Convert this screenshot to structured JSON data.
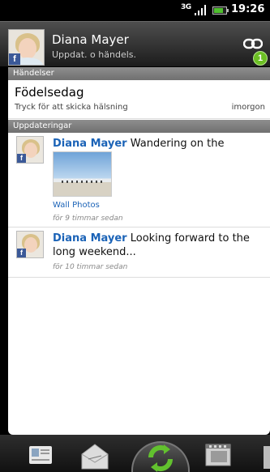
{
  "status_bar": {
    "network": "3G",
    "time": "19:26",
    "battery_level": 0.8
  },
  "contact": {
    "name": "Diana Mayer",
    "subtitle": "Uppdat. o händels.",
    "unread_count": "1",
    "facebook_badge": "f"
  },
  "sections": {
    "events_header": "Händelser",
    "updates_header": "Uppdateringar"
  },
  "event": {
    "title": "Födelsedag",
    "subtitle": "Tryck för att skicka hälsning",
    "when": "imorgon"
  },
  "updates": [
    {
      "author": "Diana Mayer",
      "text": " Wandering on the beach...",
      "album": "Wall Photos",
      "time": "för 9 timmar sedan"
    },
    {
      "author": "Diana Mayer",
      "text": " Looking forward to the long weekend...",
      "time": "för 10 timmar sedan"
    }
  ],
  "tabs": [
    {
      "icon": "contact-details-icon"
    },
    {
      "icon": "messages-icon"
    },
    {
      "icon": "updates-icon",
      "active": true
    },
    {
      "icon": "gallery-icon"
    }
  ],
  "colors": {
    "link_blue": "#1b63b7",
    "facebook_blue": "#3b5998",
    "badge_green": "#6cbf24"
  }
}
